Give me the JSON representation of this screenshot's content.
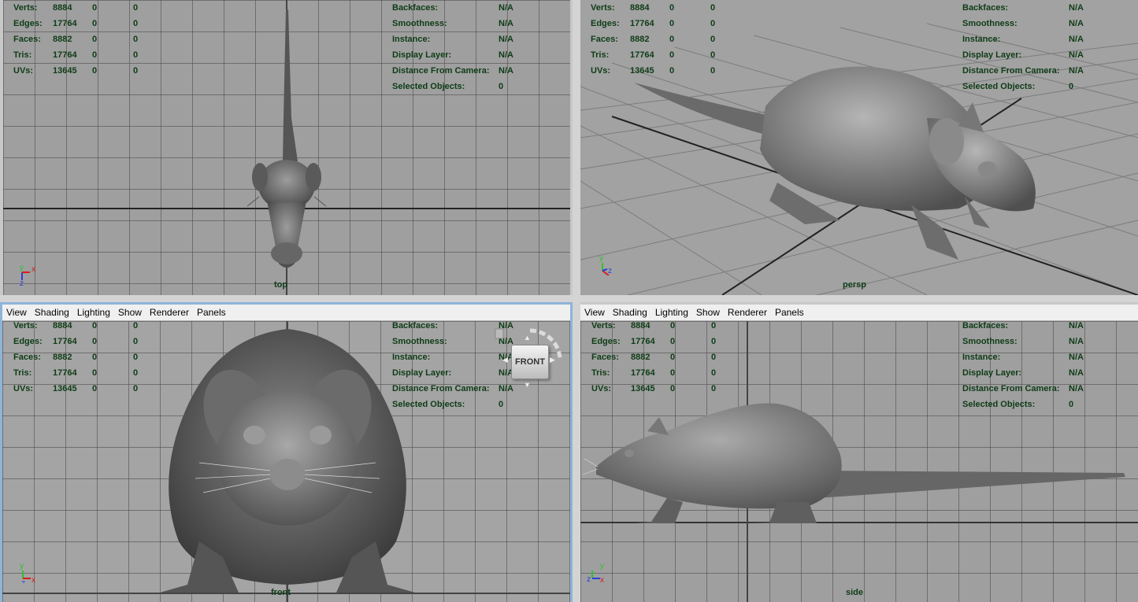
{
  "hud_stats": [
    {
      "label": "Verts:",
      "v1": "8884",
      "v2": "0",
      "v3": "0"
    },
    {
      "label": "Edges:",
      "v1": "17764",
      "v2": "0",
      "v3": "0"
    },
    {
      "label": "Faces:",
      "v1": "8882",
      "v2": "0",
      "v3": "0"
    },
    {
      "label": "Tris:",
      "v1": "17764",
      "v2": "0",
      "v3": "0"
    },
    {
      "label": "UVs:",
      "v1": "13645",
      "v2": "0",
      "v3": "0"
    }
  ],
  "hud_info": [
    {
      "label": "Backfaces:",
      "value": "N/A"
    },
    {
      "label": "Smoothness:",
      "value": "N/A"
    },
    {
      "label": "Instance:",
      "value": "N/A"
    },
    {
      "label": "Display Layer:",
      "value": "N/A"
    },
    {
      "label": "Distance From Camera:",
      "value": "N/A"
    },
    {
      "label": "Selected Objects:",
      "value": "0"
    }
  ],
  "menu": [
    "View",
    "Shading",
    "Lighting",
    "Show",
    "Renderer",
    "Panels"
  ],
  "viewports": {
    "top": {
      "camera": "top"
    },
    "persp": {
      "camera": "persp"
    },
    "front": {
      "camera": "front",
      "viewcube": "FRONT"
    },
    "side": {
      "camera": "side"
    }
  },
  "axes": {
    "x": "x",
    "y": "y",
    "z": "z"
  },
  "colors": {
    "hud_text": "#0e3c16",
    "viewport_bg": "#9f9f9f",
    "active_border": "#8fb3d9",
    "axis_x": "#d61c1c",
    "axis_y": "#2cc22c",
    "axis_z": "#2a3ddc"
  }
}
